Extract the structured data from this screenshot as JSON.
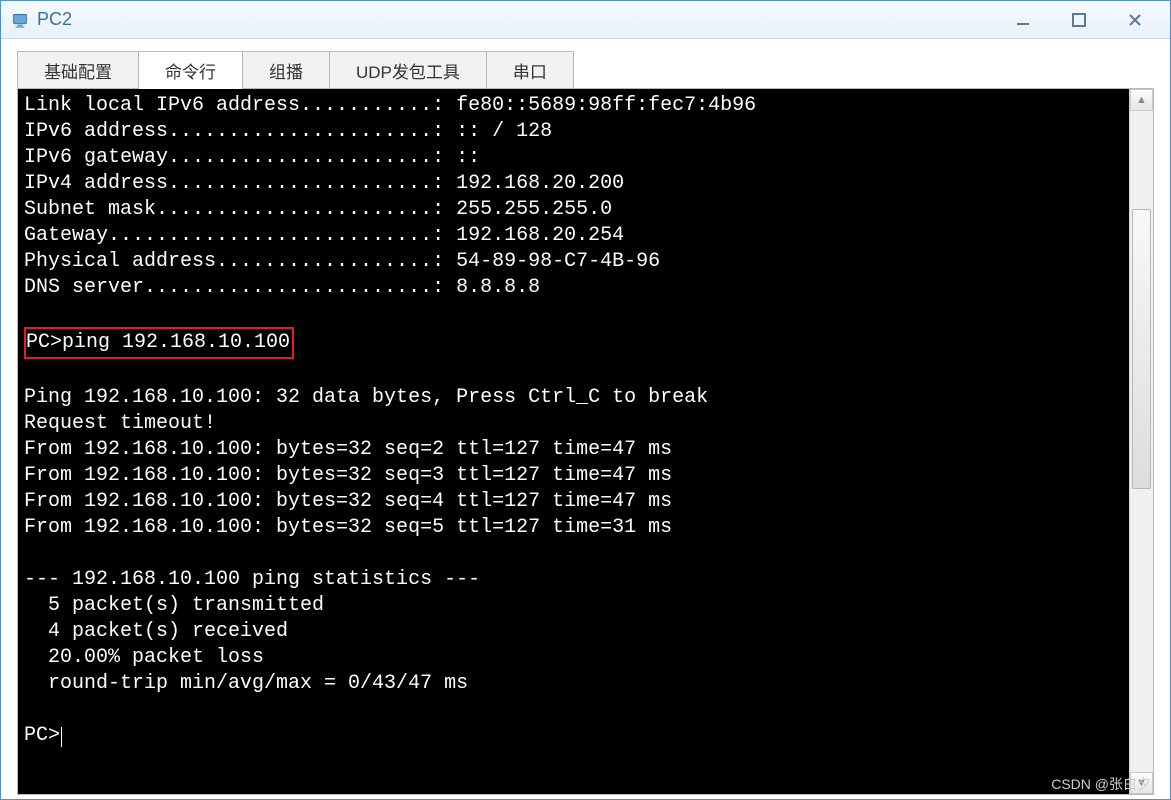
{
  "window": {
    "title": "PC2"
  },
  "tabs": [
    {
      "label": "基础配置",
      "active": false
    },
    {
      "label": "命令行",
      "active": true
    },
    {
      "label": "组播",
      "active": false
    },
    {
      "label": "UDP发包工具",
      "active": false
    },
    {
      "label": "串口",
      "active": false
    }
  ],
  "terminal": {
    "ipv6_link_local": "Link local IPv6 address...........: fe80::5689:98ff:fec7:4b96",
    "ipv6_addr": "IPv6 address......................: :: / 128",
    "ipv6_gw": "IPv6 gateway......................: ::",
    "ipv4_addr": "IPv4 address......................: 192.168.20.200",
    "subnet": "Subnet mask.......................: 255.255.255.0",
    "gateway": "Gateway...........................: 192.168.20.254",
    "phys": "Physical address..................: 54-89-98-C7-4B-96",
    "dns": "DNS server........................: 8.8.8.8",
    "prompt_cmd": "PC>ping 192.168.10.100",
    "ping_header": "Ping 192.168.10.100: 32 data bytes, Press Ctrl_C to break",
    "req_timeout": "Request timeout!",
    "reply1": "From 192.168.10.100: bytes=32 seq=2 ttl=127 time=47 ms",
    "reply2": "From 192.168.10.100: bytes=32 seq=3 ttl=127 time=47 ms",
    "reply3": "From 192.168.10.100: bytes=32 seq=4 ttl=127 time=47 ms",
    "reply4": "From 192.168.10.100: bytes=32 seq=5 ttl=127 time=31 ms",
    "stats_hdr": "--- 192.168.10.100 ping statistics ---",
    "stats_tx": "  5 packet(s) transmitted",
    "stats_rx": "  4 packet(s) received",
    "stats_loss": "  20.00% packet loss",
    "stats_rtt": "  round-trip min/avg/max = 0/43/47 ms",
    "prompt_final": "PC>"
  },
  "watermark": "CSDN @张白夕"
}
